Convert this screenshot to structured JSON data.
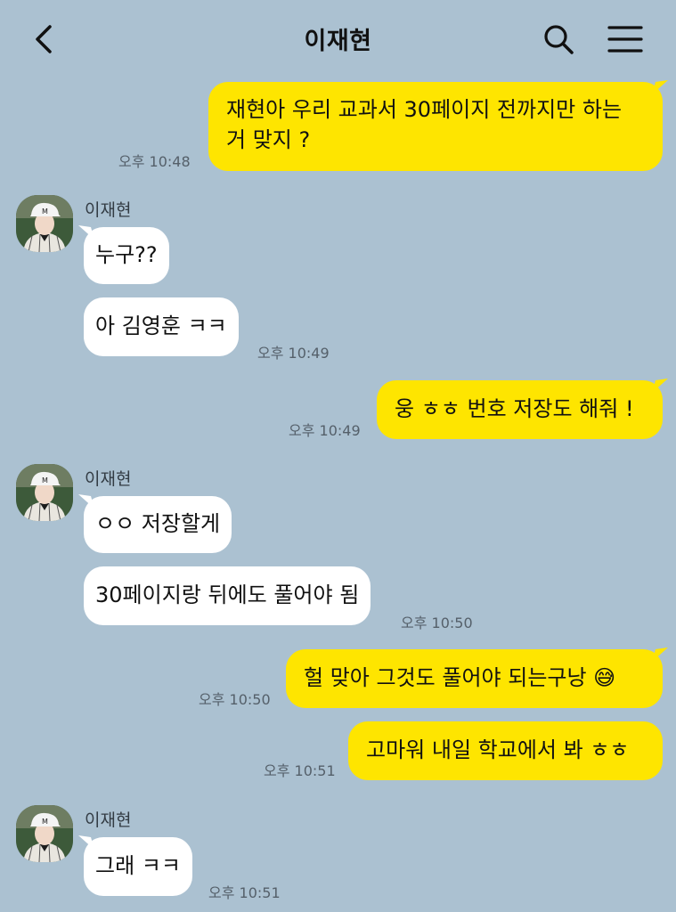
{
  "header": {
    "title": "이재현",
    "back_icon": "chevron-left-icon",
    "search_icon": "search-icon",
    "menu_icon": "hamburger-menu-icon"
  },
  "colors": {
    "background": "#abc1d1",
    "my_bubble": "#fee500",
    "their_bubble": "#ffffff"
  },
  "messages": [
    {
      "from": "me",
      "lines": [
        "재현아 우리 교과서 30페이지 전까지만 하는",
        "거 맞지 ?"
      ],
      "time": "오후 10:48"
    },
    {
      "from": "other",
      "sender": "이재현",
      "text": "누구??"
    },
    {
      "from": "other",
      "text": "아 김영훈 ㅋㅋ",
      "time": "오후 10:49"
    },
    {
      "from": "me",
      "text": "웅 ㅎㅎ 번호 저장도 해줘 !",
      "time": "오후 10:49"
    },
    {
      "from": "other",
      "sender": "이재현",
      "text": "ㅇㅇ 저장할게"
    },
    {
      "from": "other",
      "text": "30페이지랑 뒤에도 풀어야 됨",
      "time": "오후 10:50"
    },
    {
      "from": "me",
      "text": "헐 맞아 그것도 풀어야 되는구낭 😅",
      "time": "오후 10:50"
    },
    {
      "from": "me",
      "text": "고마워 내일 학교에서 봐 ㅎㅎ",
      "time": "오후 10:51"
    },
    {
      "from": "other",
      "sender": "이재현",
      "text": "그래 ㅋㅋ",
      "time": "오후 10:51"
    }
  ]
}
